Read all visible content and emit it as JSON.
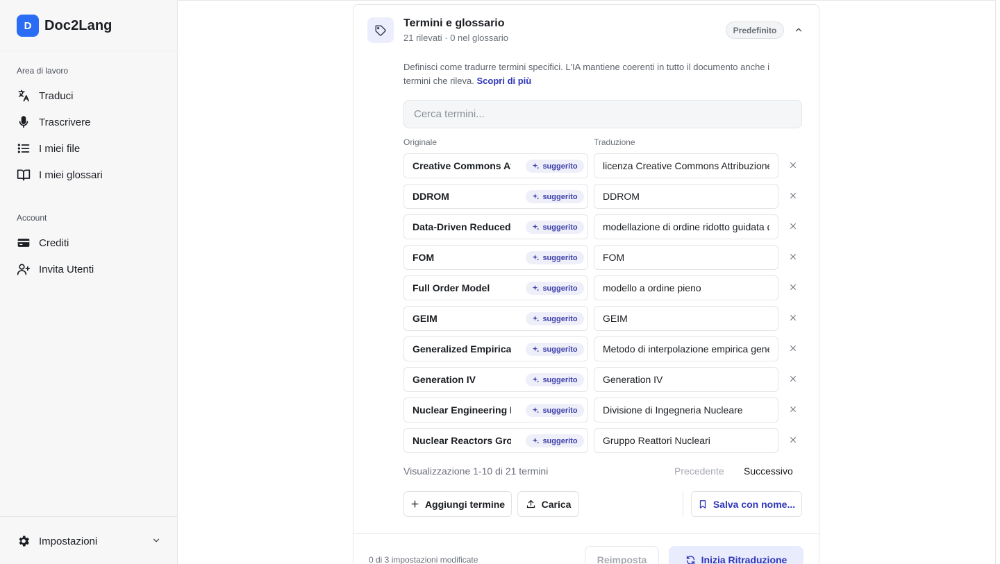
{
  "app": {
    "logo_letter": "D",
    "name": "Doc2Lang",
    "accent_color": "#2a6df4"
  },
  "sidebar": {
    "workspace_label": "Area di lavoro",
    "workspace_items": [
      {
        "label": "Traduci",
        "icon": "translate-icon"
      },
      {
        "label": "Trascrivere",
        "icon": "microphone-icon"
      },
      {
        "label": "I miei file",
        "icon": "list-icon"
      },
      {
        "label": "I miei glossari",
        "icon": "book-icon"
      }
    ],
    "account_label": "Account",
    "account_items": [
      {
        "label": "Crediti",
        "icon": "credit-card-icon"
      },
      {
        "label": "Invita Utenti",
        "icon": "user-plus-icon"
      }
    ],
    "settings_label": "Impostazioni"
  },
  "glossary": {
    "title": "Termini e glossario",
    "subtitle": "21 rilevati · 0 nel glossario",
    "badge": "Predefinito",
    "description": "Definisci come tradurre termini specifici. L'IA mantiene coerenti in tutto il documento anche i termini che rileva.",
    "learn_more": "Scopri di più",
    "search_placeholder": "Cerca termini...",
    "col_original": "Originale",
    "col_translation": "Traduzione",
    "suggested_label": "suggerito",
    "terms": [
      {
        "original": "Creative Commons Attribution",
        "translation": "licenza Creative Commons Attribuzione"
      },
      {
        "original": "DDROM",
        "translation": "DDROM"
      },
      {
        "original": "Data-Driven Reduced Order Modeling",
        "translation": "modellazione di ordine ridotto guidata dai dati"
      },
      {
        "original": "FOM",
        "translation": "FOM"
      },
      {
        "original": "Full Order Model",
        "translation": "modello a ordine pieno"
      },
      {
        "original": "GEIM",
        "translation": "GEIM"
      },
      {
        "original": "Generalized Empirical Interpolation Method",
        "translation": "Metodo di interpolazione empirica generalizzato"
      },
      {
        "original": "Generation IV",
        "translation": "Generation IV"
      },
      {
        "original": "Nuclear Engineering Division",
        "translation": "Divisione di Ingegneria Nucleare"
      },
      {
        "original": "Nuclear Reactors Group",
        "translation": "Gruppo Reattori Nucleari"
      }
    ],
    "pager_info": "Visualizzazione 1-10 di 21 termini",
    "prev_label": "Precedente",
    "next_label": "Successivo",
    "add_term_label": "Aggiungi termine",
    "upload_label": "Carica",
    "save_as_label": "Salva con nome..."
  },
  "footer": {
    "modified_info": "0 di 3 impostazioni modificate",
    "reset_label": "Reimposta",
    "start_label": "Inizia Ritraduzione"
  }
}
